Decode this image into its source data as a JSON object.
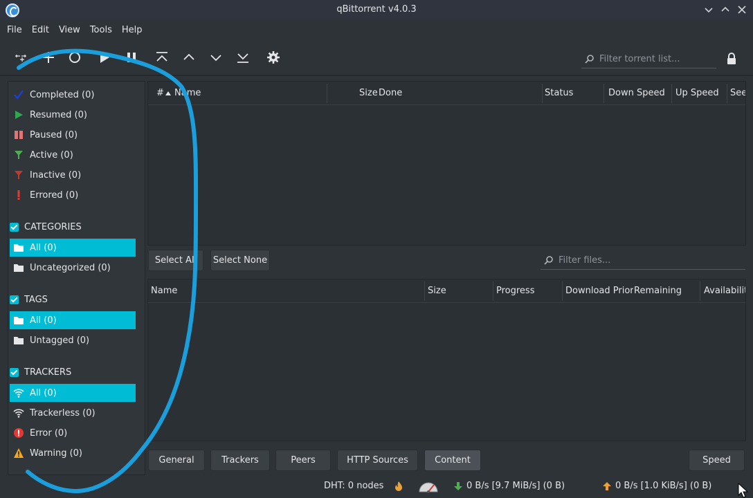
{
  "window": {
    "title": "qBittorrent v4.0.3"
  },
  "menu": [
    "File",
    "Edit",
    "View",
    "Tools",
    "Help"
  ],
  "toolbar": {
    "icons": [
      "add-link-icon",
      "add-torrent-icon",
      "remove-icon",
      "resume-icon",
      "pause-icon",
      "move-top-icon",
      "move-up-icon",
      "move-down-icon",
      "move-bottom-icon",
      "options-gear-icon"
    ],
    "filter_placeholder": "Filter torrent list..."
  },
  "sidebar": {
    "status": [
      {
        "label": "Completed (0)",
        "icon": "checkmark-icon",
        "color": "#1d4fd1"
      },
      {
        "label": "Resumed (0)",
        "icon": "play-icon",
        "color": "#2fa84f"
      },
      {
        "label": "Paused (0)",
        "icon": "pause-icon",
        "color": "#e57373"
      },
      {
        "label": "Active (0)",
        "icon": "filter-active-icon",
        "color": "#4caf50"
      },
      {
        "label": "Inactive (0)",
        "icon": "filter-inactive-icon",
        "color": "#c0392b"
      },
      {
        "label": "Errored (0)",
        "icon": "exclamation-icon",
        "color": "#e53935"
      }
    ],
    "categories": {
      "header": "CATEGORIES",
      "items": [
        {
          "label": "All (0)",
          "selected": true
        },
        {
          "label": "Uncategorized (0)",
          "selected": false
        }
      ]
    },
    "tags": {
      "header": "TAGS",
      "items": [
        {
          "label": "All (0)",
          "selected": true
        },
        {
          "label": "Untagged (0)",
          "selected": false
        }
      ]
    },
    "trackers": {
      "header": "TRACKERS",
      "items": [
        {
          "label": "All (0)",
          "selected": true,
          "icon": "wifi-icon"
        },
        {
          "label": "Trackerless (0)",
          "selected": false,
          "icon": "wifi-icon"
        },
        {
          "label": "Error (0)",
          "selected": false,
          "icon": "error-icon"
        },
        {
          "label": "Warning (0)",
          "selected": false,
          "icon": "warning-icon"
        }
      ]
    }
  },
  "torrent_list": {
    "columns": [
      "#",
      "Name",
      "Size",
      "Done",
      "Status",
      "Down Speed",
      "Up Speed",
      "See"
    ]
  },
  "content": {
    "select_all": "Select All",
    "select_none": "Select None",
    "filter_placeholder": "Filter files...",
    "columns": [
      "Name",
      "Size",
      "Progress",
      "Download Priori",
      "Remaining",
      "Availabilit"
    ]
  },
  "tabs": [
    "General",
    "Trackers",
    "Peers",
    "HTTP Sources",
    "Content"
  ],
  "active_tab": "Content",
  "speed_button": "Speed",
  "status_bar": {
    "dht": "DHT: 0 nodes",
    "download": "0 B/s [9.7 MiB/s] (0 B)",
    "upload": "0 B/s [1.0 KiB/s] (0 B)"
  },
  "colors": {
    "accent": "#00bcd4",
    "background": "#2e3338",
    "annotation_stroke": "#1a9fdc"
  }
}
